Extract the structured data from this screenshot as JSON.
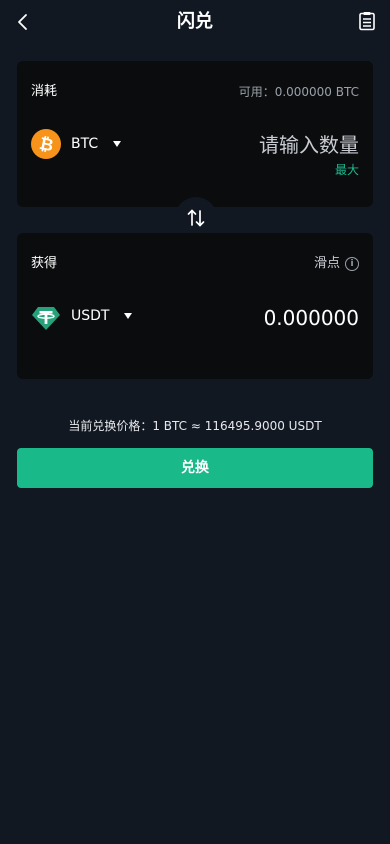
{
  "header": {
    "title": "闪兑",
    "back_icon": "chevron-left-icon",
    "history_icon": "document-list-icon"
  },
  "pay": {
    "label": "消耗",
    "available": "可用：0.000000 BTC",
    "coin": "BTC",
    "coin_icon": "bitcoin-icon",
    "amount_placeholder": "请输入数量",
    "max_label": "最大"
  },
  "swap_icon": "swap-vertical-icon",
  "receive": {
    "label": "获得",
    "slippage_label": "滑点",
    "info_icon": "info-icon",
    "coin": "USDT",
    "coin_icon": "tether-icon",
    "amount": "0.000000"
  },
  "rate_text": "当前兑换价格：1 BTC ≈ 116495.9000 USDT",
  "submit_label": "兑换",
  "colors": {
    "background": "#111822",
    "card": "#0b0c0e",
    "accent": "#19b98a",
    "bitcoin": "#f7931a",
    "tether": "#26a17b"
  }
}
